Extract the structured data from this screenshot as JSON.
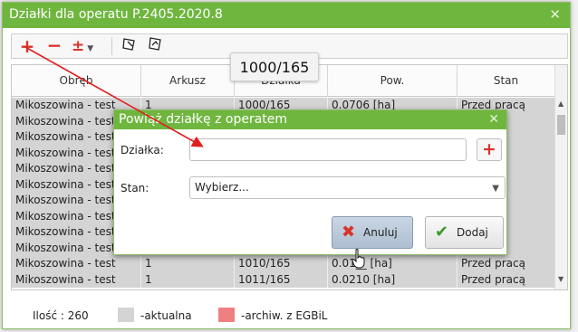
{
  "window": {
    "title": "Działki dla operatu P.2405.2020.8"
  },
  "toolbar": {
    "add": "+",
    "remove": "−",
    "plusminus": "±"
  },
  "grid": {
    "columns": [
      "Obręb",
      "Arkusz",
      "Działka",
      "Pow.",
      "Stan"
    ],
    "rows": [
      {
        "obreb": "Mikoszowina - test",
        "arkusz": "1",
        "dzialka": "1000/165",
        "pow": "0.0706 [ha]",
        "stan": "Przed pracą"
      },
      {
        "obreb": "Mikoszowina - test",
        "arkusz": "",
        "dzialka": "",
        "pow": "",
        "stan": "pracą"
      },
      {
        "obreb": "Mikoszowina - test",
        "arkusz": "",
        "dzialka": "",
        "pow": "",
        "stan": "pracą"
      },
      {
        "obreb": "Mikoszowina - test",
        "arkusz": "",
        "dzialka": "",
        "pow": "",
        "stan": "pracą"
      },
      {
        "obreb": "Mikoszowina - test",
        "arkusz": "",
        "dzialka": "",
        "pow": "",
        "stan": "pracą"
      },
      {
        "obreb": "Mikoszowina - test",
        "arkusz": "",
        "dzialka": "",
        "pow": "",
        "stan": "pracą"
      },
      {
        "obreb": "Mikoszowina - test",
        "arkusz": "",
        "dzialka": "",
        "pow": "",
        "stan": "pracą"
      },
      {
        "obreb": "Mikoszowina - test",
        "arkusz": "",
        "dzialka": "",
        "pow": "",
        "stan": "pracą"
      },
      {
        "obreb": "Mikoszowina - test",
        "arkusz": "",
        "dzialka": "",
        "pow": "",
        "stan": "pracą"
      },
      {
        "obreb": "Mikoszowina - test",
        "arkusz": "",
        "dzialka": "",
        "pow": "",
        "stan": "pracą"
      },
      {
        "obreb": "Mikoszowina - test",
        "arkusz": "1",
        "dzialka": "1010/165",
        "pow": "0.01__ [ha]",
        "stan": "Przed pracą"
      },
      {
        "obreb": "Mikoszowina - test",
        "arkusz": "1",
        "dzialka": "1011/165",
        "pow": "0.0210 [ha]",
        "stan": "Przed pracą"
      }
    ]
  },
  "footer": {
    "count": "Ilość : 260",
    "legend_current": "-aktualna",
    "legend_archived": "-archiw. z EGBiL",
    "color_current": "#d4d4d4",
    "color_archived": "#f08080"
  },
  "tooltip": {
    "text": "1000/165"
  },
  "dialog": {
    "title": "Powiąż działkę z operatem",
    "parcel_label": "Działka:",
    "parcel_value": "",
    "add_icon": "+",
    "state_label": "Stan:",
    "state_value": "Wybierz...",
    "cancel_label": "Anuluj",
    "confirm_label": "Dodaj"
  },
  "colors": {
    "accent": "#6fb63f",
    "danger": "#d9342b"
  }
}
